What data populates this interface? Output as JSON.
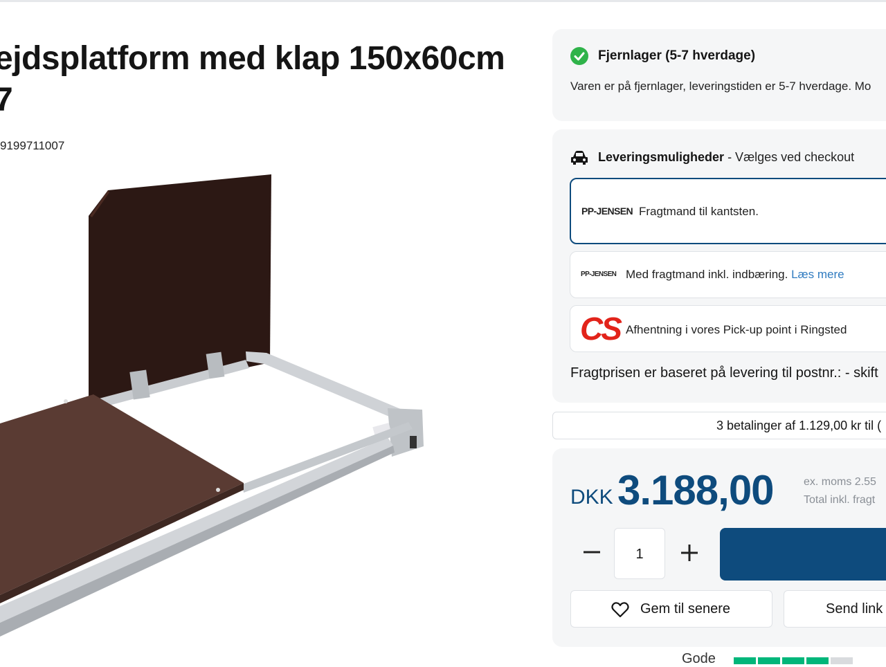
{
  "product": {
    "title_line1": "ejdsplatform med klap 150x60cm",
    "title_line2": "7",
    "sku": "9199711007"
  },
  "stock": {
    "title": "Fjernlager (5-7 hverdage)",
    "description": "Varen er på fjernlager, leveringstiden er 5-7 hverdage. Mo"
  },
  "delivery": {
    "heading": "Leveringsmuligheder",
    "heading_suffix": " - Vælges ved checkout",
    "options": [
      {
        "logo": "PP-JENSEN",
        "text": "Fragtmand til kantsten.",
        "selected": true
      },
      {
        "logo": "PP-JENSEN",
        "text": "Med fragtmand inkl. indbæring.",
        "link": "Læs mere"
      },
      {
        "logo": "CS",
        "text": "Afhentning i vores Pick-up point i Ringsted"
      }
    ],
    "freight_note": "Fragtprisen er baseret på levering til postnr.: - skift"
  },
  "installments": {
    "text": "3 betalinger af 1.129,00 kr til ("
  },
  "price": {
    "currency": "DKK",
    "amount": "3.188,00",
    "ex_moms": "ex. moms 2.55",
    "total": "Total inkl. fragt"
  },
  "cart": {
    "quantity": "1"
  },
  "actions": {
    "save_label": "Gem til senere",
    "send_label": "Send link"
  },
  "colors": {
    "brand_blue": "#0e4b7d",
    "stock_green": "#2fb34a",
    "cs_red": "#e2231a",
    "link_blue": "#2f7bc0",
    "trust_green": "#00b67a"
  },
  "rating": {
    "prefix": "Gode",
    "stars_filled": 4,
    "stars_total": 5
  }
}
